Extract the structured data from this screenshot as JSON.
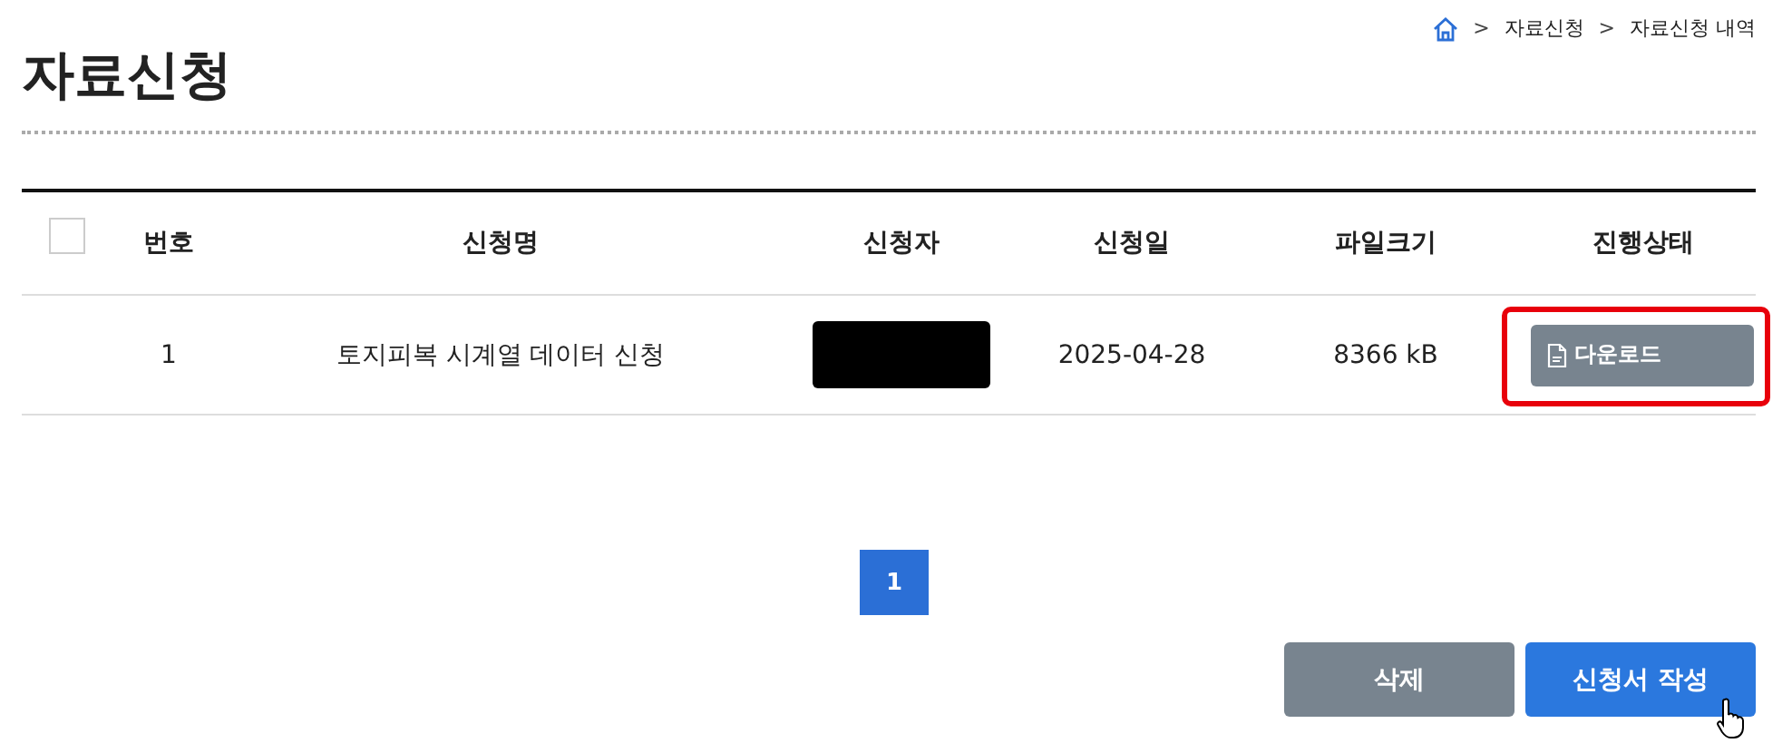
{
  "page_title": "자료신청",
  "breadcrumb": [
    {
      "label": "자료신청"
    },
    {
      "label": "자료신청 내역"
    }
  ],
  "breadcrumb_separator": ">",
  "table": {
    "select_all": {
      "checked": false
    },
    "columns": [
      "번호",
      "신청명",
      "신청자",
      "신청일",
      "파일크기",
      "진행상태"
    ],
    "rows": [
      {
        "number": "1",
        "title": "토지피복 시계열 데이터 신청",
        "applicant": {
          "kind": "redacted"
        },
        "date": "2025-04-28",
        "file_size": "8366 kB",
        "action": "다운로드",
        "highlighted": true
      }
    ]
  },
  "pagination": [
    {
      "label": "1",
      "selected": true
    }
  ],
  "buttons": [
    {
      "label": "삭제",
      "kind": "secondary"
    },
    {
      "label": "신청서 작성",
      "kind": "primary"
    }
  ]
}
